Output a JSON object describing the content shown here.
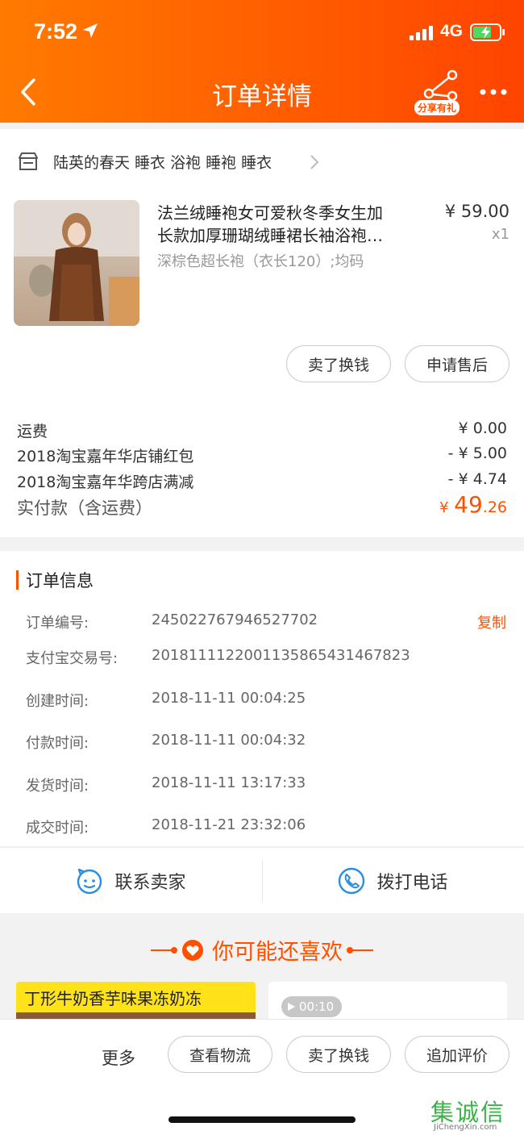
{
  "status_bar": {
    "time": "7:52",
    "network": "4G"
  },
  "nav": {
    "title": "订单详情",
    "share_badge": "分享有礼"
  },
  "shop": {
    "name": "陆英的春天 睡衣 浴袍 睡袍 睡衣"
  },
  "product": {
    "title_line1": "法兰绒睡袍女可爱秋冬季女生加",
    "title_line2": "长款加厚珊瑚绒睡裙长袖浴袍…",
    "sku": "深棕色超长袍（衣长120）;均码",
    "price": "¥ 59.00",
    "quantity": "x1"
  },
  "item_actions": {
    "sell_label": "卖了换钱",
    "after_sale_label": "申请售后"
  },
  "fees": [
    {
      "label": "运费",
      "value": "¥ 0.00"
    },
    {
      "label": "2018淘宝嘉年华店铺红包",
      "value": "- ¥ 5.00"
    },
    {
      "label": "2018淘宝嘉年华跨店满减",
      "value": "- ¥ 4.74"
    }
  ],
  "total": {
    "label": "实付款（含运费）",
    "currency": "¥",
    "integer": "49",
    "decimal": ".26"
  },
  "order_info": {
    "title": "订单信息",
    "copy_label": "复制",
    "rows": [
      {
        "label": "订单编号:",
        "value": "245022767946527702"
      },
      {
        "label": "支付宝交易号:",
        "value": "2018111122001135865431467823"
      },
      {
        "label": "创建时间:",
        "value": "2018-11-11 00:04:25"
      },
      {
        "label": "付款时间:",
        "value": "2018-11-11 00:04:32"
      },
      {
        "label": "发货时间:",
        "value": "2018-11-11 13:17:33"
      },
      {
        "label": "成交时间:",
        "value": "2018-11-21 23:32:06"
      }
    ]
  },
  "contact": {
    "seller_label": "联系卖家",
    "call_label": "拨打电话"
  },
  "recommend": {
    "title": "你可能还喜欢",
    "left_card_title": "丁形牛奶香芋味果冻奶冻",
    "video_duration": "00:10"
  },
  "bottom_bar": {
    "more_label": "更多",
    "logistics_label": "查看物流",
    "sell_label": "卖了换钱",
    "review_label": "追加评价"
  },
  "watermark": {
    "glyphs": "集诚信",
    "url": "JiChengXin.com"
  },
  "colors": {
    "accent": "#ff5000",
    "header_start": "#ff7a00",
    "header_end": "#ff4400",
    "watermark_green": "#3db24a"
  }
}
